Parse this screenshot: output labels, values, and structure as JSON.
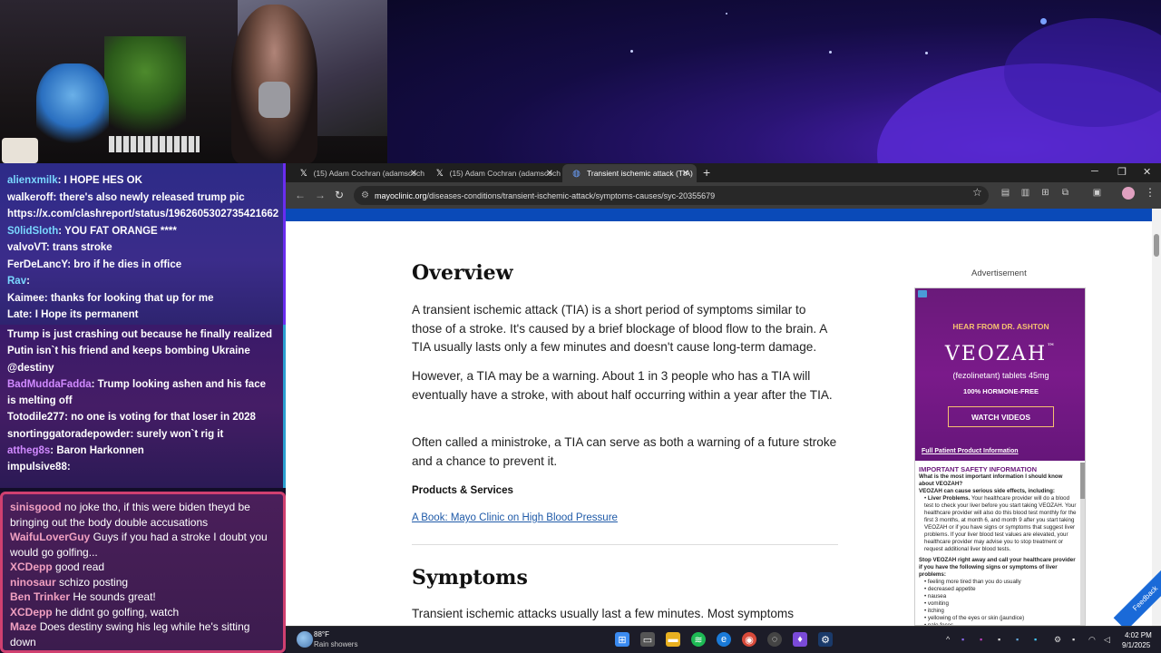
{
  "chat_top": [
    {
      "user": "alienxmilk",
      "color": "#7ad8ff",
      "text": "I HOPE HES OK"
    },
    {
      "user": "walkeroff",
      "color": "#ffffff",
      "text": "there's also newly released trump pic"
    },
    {
      "user": "",
      "color": "#ffffff",
      "text": "https://x.com/clashreport/status/1962605302735421662"
    },
    {
      "user": "S0lidSloth",
      "color": "#7ad8ff",
      "text": "YOU FAT ORANGE ****"
    },
    {
      "user": "valvoVT",
      "color": "#ffffff",
      "text": "trans stroke"
    },
    {
      "user": "FerDeLancY",
      "color": "#ffffff",
      "text": "bro if he dies in office"
    },
    {
      "user": "Rav",
      "color": "#7ad8ff",
      "text": ""
    },
    {
      "user": "Kaimee",
      "color": "#ffffff",
      "text": "thanks for looking that up for me"
    },
    {
      "user": "Late",
      "color": "#ffffff",
      "text": "I Hope its permanent"
    }
  ],
  "chat_mid": [
    {
      "user": "",
      "color": "#ffffff",
      "text": "Trump is just crashing out because he finally realized Putin isn`t his friend and keeps bombing Ukraine @destiny"
    },
    {
      "user": "BadMuddaFadda",
      "color": "#d08aff",
      "text": "Trump looking ashen and his face is melting off"
    },
    {
      "user": "Totodile277",
      "color": "#ffffff",
      "text": "no one is voting for that loser in 2028"
    },
    {
      "user": "snortinggatoradepowder",
      "color": "#ffffff",
      "text": "surely won`t rig it"
    },
    {
      "user": "attheg8s",
      "color": "#d08aff",
      "text": "Baron Harkonnen"
    },
    {
      "user": "impulsive88",
      "color": "#ffffff",
      "text": ""
    }
  ],
  "chat_bottom": [
    {
      "user": "sinisgood",
      "color": "#f0a0c0",
      "text": "no joke tho, if this were biden theyd be bringing out the body double accusations"
    },
    {
      "user": "WaifuLoverGuy",
      "color": "#f0a0c0",
      "text": "Guys if you had a stroke I doubt you would go golfing..."
    },
    {
      "user": "XCDepp",
      "color": "#f0a0c0",
      "text": "good read"
    },
    {
      "user": "ninosaur",
      "color": "#f0a0c0",
      "text": "schizo posting"
    },
    {
      "user": "Ben Trinker",
      "color": "#f0a0c0",
      "text": "He sounds great!"
    },
    {
      "user": "XCDepp",
      "color": "#f0a0c0",
      "text": "he didnt go golfing, watch"
    },
    {
      "user": "Maze",
      "color": "#f0a0c0",
      "text": "Does destiny swing his leg while he's sitting down"
    }
  ],
  "browser": {
    "tabs": [
      {
        "title": "(15) Adam Cochran (adamscoch",
        "icon": "𝕏"
      },
      {
        "title": "(15) Adam Cochran (adamscoch",
        "icon": "𝕏"
      },
      {
        "title": "Transient ischemic attack (TIA)",
        "icon": "◍"
      }
    ],
    "url_host": "mayoclinic.org",
    "url_path": "/diseases-conditions/transient-ischemic-attack/symptoms-causes/syc-20355679"
  },
  "article": {
    "h_overview": "Overview",
    "p1": "A transient ischemic attack (TIA) is a short period of symptoms similar to those of a stroke. It's caused by a brief blockage of blood flow to the brain. A TIA usually lasts only a few minutes and doesn't cause long-term damage.",
    "p2": "However, a TIA may be a warning. About 1 in 3 people who has a TIA will eventually have a stroke, with about half occurring within a year after the TIA.",
    "p3": "Often called a ministroke, a TIA can serve as both a warning of a future stroke and a chance to prevent it.",
    "ps_label": "Products & Services",
    "ps_link": "A Book: Mayo Clinic on High Blood Pressure",
    "h_symptoms": "Symptoms",
    "p4": "Transient ischemic attacks usually last a few minutes. Most symptoms"
  },
  "ad": {
    "label": "Advertisement",
    "hear": "HEAR FROM DR. ASHTON",
    "brand": "VEOZAH",
    "tm": "™",
    "sub": "(fezolinetant) tablets 45mg",
    "hormone": "100% HORMONE-FREE",
    "button": "WATCH VIDEOS",
    "fppi": "Full Patient Product Information",
    "isi_title": "IMPORTANT SAFETY INFORMATION",
    "isi_q": "What is the most important information I should know about VEOZAH?",
    "isi_se": "VEOZAH can cause serious side effects, including:",
    "isi_liver_h": "Liver Problems.",
    "isi_liver": "Your healthcare provider will do a blood test to check your liver before you start taking VEOZAH. Your healthcare provider will also do this blood test monthly for the first 3 months, at month 6, and month 9 after you start taking VEOZAH or if you have signs or symptoms that suggest liver problems. If your liver blood test values are elevated, your healthcare provider may advise you to stop treatment or request additional liver blood tests.",
    "isi_stop": "Stop VEOZAH right away and call your healthcare provider if you have the following signs or symptoms of liver problems:",
    "isi_list": [
      "feeling more tired than you do usually",
      "decreased appetite",
      "nausea",
      "vomiting",
      "itching",
      "yellowing of the eyes or skin (jaundice)",
      "pale feces"
    ],
    "feedback": "Feedback"
  },
  "taskbar": {
    "temp": "88°F",
    "weather": "Rain showers",
    "time": "4:02 PM",
    "date": "9/1/2025"
  }
}
